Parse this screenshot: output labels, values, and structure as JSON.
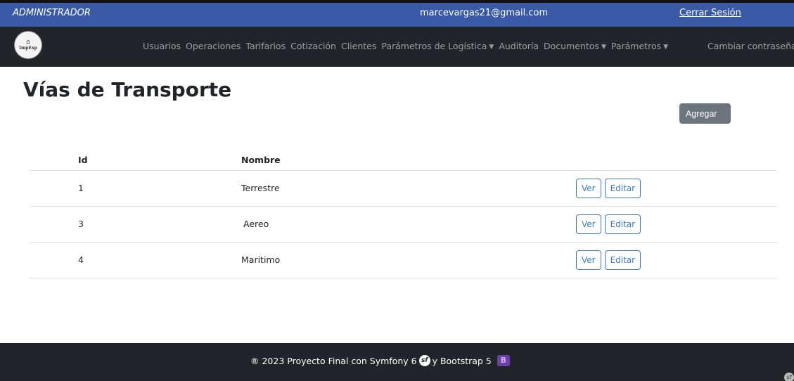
{
  "topbar": {
    "role": "ADMINISTRADOR",
    "email": "marcevargas21@gmail.com",
    "logout": "Cerrar Sesión"
  },
  "navbar": {
    "logo_text": "ImpExp",
    "items": [
      {
        "label": "Usuarios"
      },
      {
        "label": "Operaciones"
      },
      {
        "label": "Tarifarios"
      },
      {
        "label": "Cotización"
      },
      {
        "label": "Clientes"
      },
      {
        "label": "Parámetros de Logística"
      },
      {
        "label": "Auditoría"
      },
      {
        "label": "Documentos"
      },
      {
        "label": "Parámetros"
      }
    ],
    "right_link": "Cambiar contraseña"
  },
  "page": {
    "title": "Vías de Transporte",
    "add_button": "Agregar"
  },
  "table": {
    "headers": [
      "Id",
      "Nombre"
    ],
    "rows": [
      {
        "id": "1",
        "nombre": "Terrestre",
        "view": "Ver",
        "edit": "Editar"
      },
      {
        "id": "3",
        "nombre": "Aereo",
        "view": "Ver",
        "edit": "Editar"
      },
      {
        "id": "4",
        "nombre": "Maritimo",
        "view": "Ver",
        "edit": "Editar"
      }
    ]
  },
  "footer": {
    "text_before": "® 2023 Proyecto Final con Symfony 6",
    "text_after": "y Bootstrap 5",
    "symfony_icon": "sf",
    "bootstrap_icon": "B"
  },
  "colors": {
    "topbar": "#3a5aa6",
    "navbar": "#212529",
    "primary_outline": "#3a7bd5",
    "secondary": "#6c757d"
  }
}
